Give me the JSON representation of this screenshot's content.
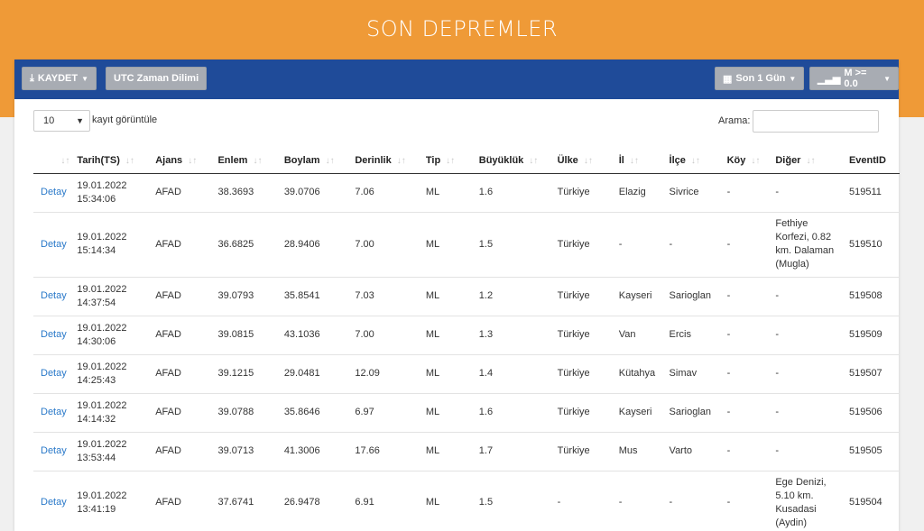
{
  "header": {
    "title": "SON DEPREMLER"
  },
  "toolbar": {
    "save_label": "KAYDET",
    "utc_label": "UTC Zaman Dilimi",
    "period_label": "Son 1 Gün",
    "magnitude_label": "M >= 0.0"
  },
  "controls": {
    "page_length": "10",
    "page_length_label": "kayıt görüntüle",
    "search_label": "Arama:",
    "search_value": ""
  },
  "table": {
    "columns": [
      "",
      "Tarih(TS)",
      "Ajans",
      "Enlem",
      "Boylam",
      "Derinlik",
      "Tip",
      "Büyüklük",
      "Ülke",
      "İl",
      "İlçe",
      "Köy",
      "Diğer",
      "EventID"
    ],
    "sort_icons": [
      "↓↑",
      "↓↑",
      "↓↑",
      "↓↑",
      "↓↑",
      "↓↑",
      "↓↑",
      "↓↑",
      "↓↑",
      "↓↑",
      "↓↑",
      "↓↑",
      "↓↑",
      ""
    ],
    "rows": [
      {
        "detail": "Detay",
        "date": "19.01.2022",
        "time": "15:34:06",
        "agency": "AFAD",
        "lat": "38.3693",
        "lon": "39.0706",
        "depth": "7.06",
        "type": "ML",
        "mag": "1.6",
        "country": "Türkiye",
        "province": "Elazig",
        "district": "Sivrice",
        "village": "-",
        "other": "-",
        "eventid": "519511"
      },
      {
        "detail": "Detay",
        "date": "19.01.2022",
        "time": "15:14:34",
        "agency": "AFAD",
        "lat": "36.6825",
        "lon": "28.9406",
        "depth": "7.00",
        "type": "ML",
        "mag": "1.5",
        "country": "Türkiye",
        "province": "-",
        "district": "-",
        "village": "-",
        "other": "Fethiye Korfezi, 0.82 km. Dalaman (Mugla)",
        "eventid": "519510"
      },
      {
        "detail": "Detay",
        "date": "19.01.2022",
        "time": "14:37:54",
        "agency": "AFAD",
        "lat": "39.0793",
        "lon": "35.8541",
        "depth": "7.03",
        "type": "ML",
        "mag": "1.2",
        "country": "Türkiye",
        "province": "Kayseri",
        "district": "Sarioglan",
        "village": "-",
        "other": "-",
        "eventid": "519508"
      },
      {
        "detail": "Detay",
        "date": "19.01.2022",
        "time": "14:30:06",
        "agency": "AFAD",
        "lat": "39.0815",
        "lon": "43.1036",
        "depth": "7.00",
        "type": "ML",
        "mag": "1.3",
        "country": "Türkiye",
        "province": "Van",
        "district": "Ercis",
        "village": "-",
        "other": "-",
        "eventid": "519509"
      },
      {
        "detail": "Detay",
        "date": "19.01.2022",
        "time": "14:25:43",
        "agency": "AFAD",
        "lat": "39.1215",
        "lon": "29.0481",
        "depth": "12.09",
        "type": "ML",
        "mag": "1.4",
        "country": "Türkiye",
        "province": "Kütahya",
        "district": "Simav",
        "village": "-",
        "other": "-",
        "eventid": "519507"
      },
      {
        "detail": "Detay",
        "date": "19.01.2022",
        "time": "14:14:32",
        "agency": "AFAD",
        "lat": "39.0788",
        "lon": "35.8646",
        "depth": "6.97",
        "type": "ML",
        "mag": "1.6",
        "country": "Türkiye",
        "province": "Kayseri",
        "district": "Sarioglan",
        "village": "-",
        "other": "-",
        "eventid": "519506"
      },
      {
        "detail": "Detay",
        "date": "19.01.2022",
        "time": "13:53:44",
        "agency": "AFAD",
        "lat": "39.0713",
        "lon": "41.3006",
        "depth": "17.66",
        "type": "ML",
        "mag": "1.7",
        "country": "Türkiye",
        "province": "Mus",
        "district": "Varto",
        "village": "-",
        "other": "-",
        "eventid": "519505"
      },
      {
        "detail": "Detay",
        "date": "19.01.2022",
        "time": "13:41:19",
        "agency": "AFAD",
        "lat": "37.6741",
        "lon": "26.9478",
        "depth": "6.91",
        "type": "ML",
        "mag": "1.5",
        "country": "-",
        "province": "-",
        "district": "-",
        "village": "-",
        "other": "Ege Denizi, 5.10 km. Kusadasi (Aydin)",
        "eventid": "519504"
      }
    ]
  }
}
